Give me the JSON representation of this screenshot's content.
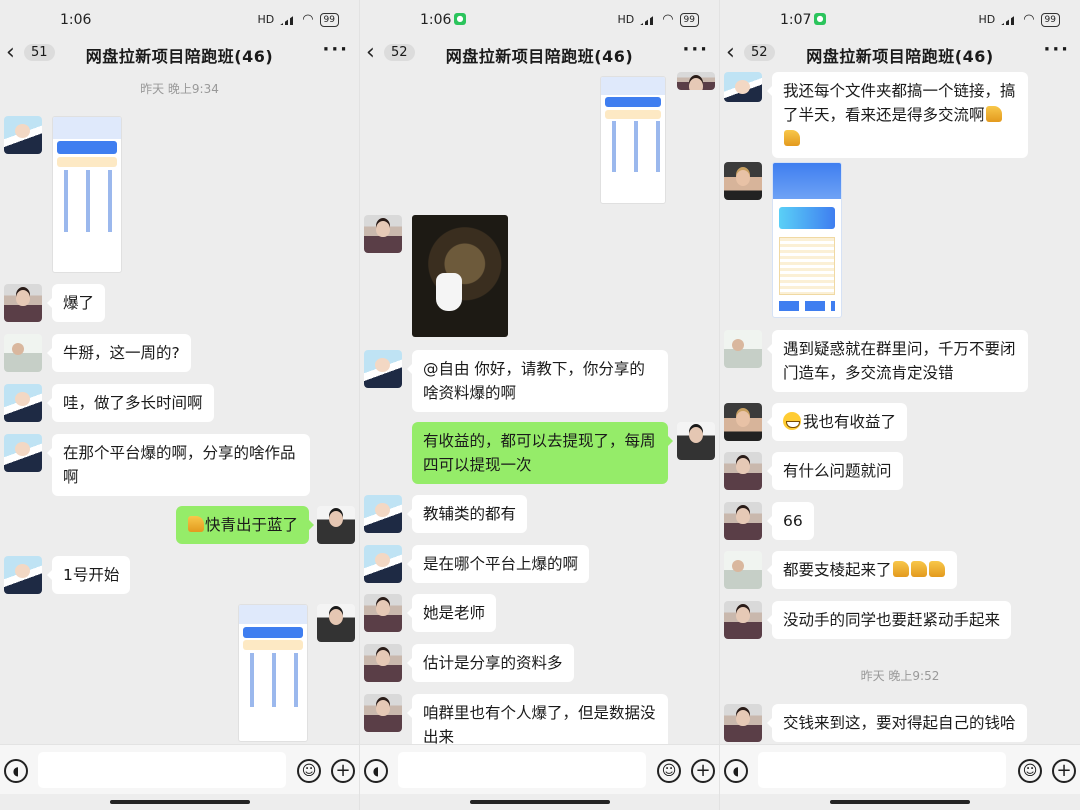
{
  "status": {
    "times": [
      "1:06",
      "1:06",
      "1:07"
    ],
    "battery": "99",
    "network": "HD"
  },
  "header": {
    "title": "网盘拉新项目陪跑班(46)",
    "unread": [
      "51",
      "52",
      "52"
    ]
  },
  "panel1": {
    "timestamp": "昨天 晚上9:34",
    "messages": {
      "m1": "爆了",
      "m2": "牛掰，这一周的?",
      "m3": "哇，做了多长时间啊",
      "m4": "在那个平台爆的啊，分享的啥作品啊",
      "m5": "快青出于蓝了",
      "m6": "1号开始"
    }
  },
  "panel2": {
    "messages": {
      "m1": "@自由  你好，请教下，你分享的啥资料爆的啊",
      "m2": "有收益的，都可以去提现了，每周四可以提现一次",
      "m3": "教辅类的都有",
      "m4": "是在哪个平台上爆的啊",
      "m5": "她是老师",
      "m6": "估计是分享的资料多",
      "m7": "咱群里也有个人爆了，但是数据没出来"
    }
  },
  "panel3": {
    "timestamp": "昨天 晚上9:52",
    "messages": {
      "m1": "我还每个文件夹都搞一个链接，搞了半天，看来还是得多交流啊",
      "m2": "遇到疑惑就在群里问，千万不要闭门造车，多交流肯定没错",
      "m3": "我也有收益了",
      "m4": "有什么问题就问",
      "m5": "66",
      "m6": "都要支棱起来了",
      "m7": "没动手的同学也要赶紧动手起来",
      "m8": "交钱来到这，要对得起自己的钱哈"
    }
  },
  "icons": {
    "voice": "voice-icon",
    "emoji": "emoji-icon",
    "plus": "plus-icon",
    "back": "back-chevron-icon",
    "more": "more-icon"
  },
  "colors": {
    "background": "#ededed",
    "self_bubble": "#95ec69",
    "other_bubble": "#ffffff"
  }
}
